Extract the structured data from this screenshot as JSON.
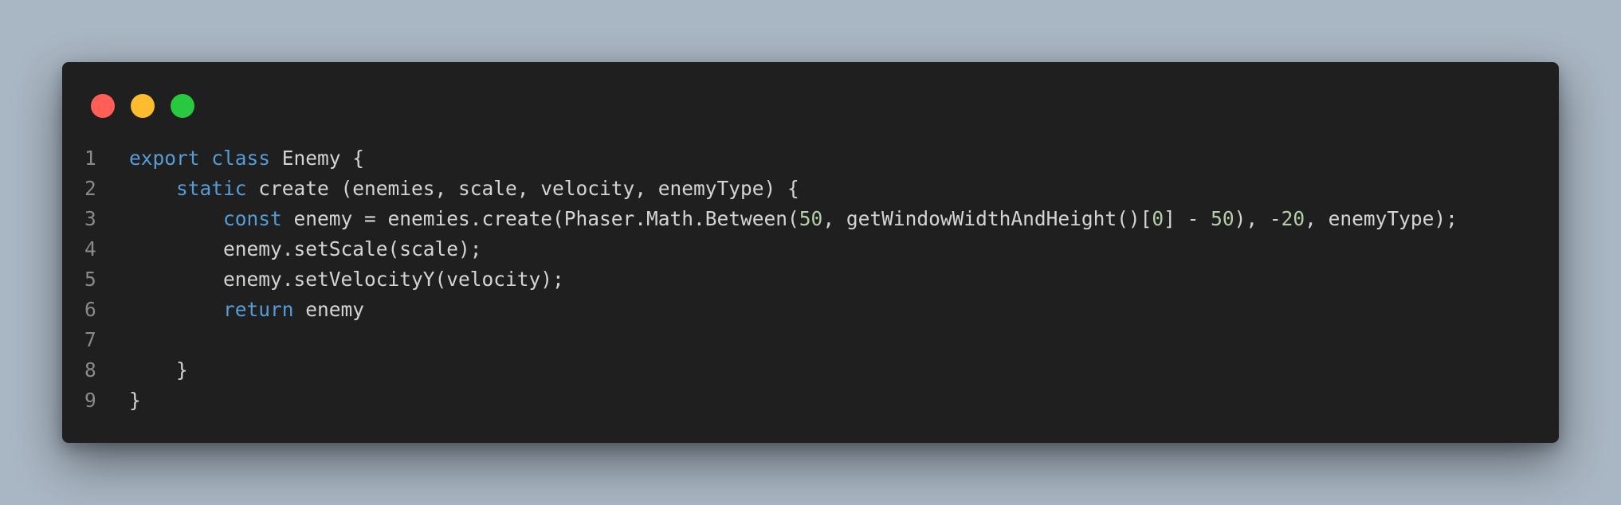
{
  "window": {
    "buttons": {
      "close": "close",
      "minimize": "minimize",
      "maximize": "maximize"
    }
  },
  "colors": {
    "background": "#a9b6c3",
    "editor_bg": "#1f1f1f",
    "keyword": "#569cd6",
    "number": "#b5cea8",
    "text": "#d4d4d4",
    "line_number": "#8a8a8a",
    "close_dot": "#ff5f57",
    "minimize_dot": "#febc2e",
    "maximize_dot": "#28c840"
  },
  "code": {
    "lines": [
      {
        "number": "1",
        "tokens": [
          {
            "type": "kw",
            "text": "export"
          },
          {
            "type": "plain",
            "text": " "
          },
          {
            "type": "kw",
            "text": "class"
          },
          {
            "type": "plain",
            "text": " Enemy {"
          }
        ]
      },
      {
        "number": "2",
        "tokens": [
          {
            "type": "plain",
            "text": "    "
          },
          {
            "type": "kw",
            "text": "static"
          },
          {
            "type": "plain",
            "text": " create (enemies, scale, velocity, enemyType) {"
          }
        ]
      },
      {
        "number": "3",
        "tokens": [
          {
            "type": "plain",
            "text": "        "
          },
          {
            "type": "kw",
            "text": "const"
          },
          {
            "type": "plain",
            "text": " enemy = enemies.create(Phaser.Math.Between("
          },
          {
            "type": "num",
            "text": "50"
          },
          {
            "type": "plain",
            "text": ", getWindowWidthAndHeight()["
          },
          {
            "type": "num",
            "text": "0"
          },
          {
            "type": "plain",
            "text": "] - "
          },
          {
            "type": "num",
            "text": "50"
          },
          {
            "type": "plain",
            "text": "), -"
          },
          {
            "type": "num",
            "text": "20"
          },
          {
            "type": "plain",
            "text": ", enemyType);"
          }
        ]
      },
      {
        "number": "4",
        "tokens": [
          {
            "type": "plain",
            "text": "        enemy.setScale(scale);"
          }
        ]
      },
      {
        "number": "5",
        "tokens": [
          {
            "type": "plain",
            "text": "        enemy.setVelocityY(velocity);"
          }
        ]
      },
      {
        "number": "6",
        "tokens": [
          {
            "type": "plain",
            "text": "        "
          },
          {
            "type": "kw",
            "text": "return"
          },
          {
            "type": "plain",
            "text": " enemy"
          }
        ]
      },
      {
        "number": "7",
        "tokens": []
      },
      {
        "number": "8",
        "tokens": [
          {
            "type": "plain",
            "text": "    }"
          }
        ]
      },
      {
        "number": "9",
        "tokens": [
          {
            "type": "plain",
            "text": "}"
          }
        ]
      }
    ]
  }
}
